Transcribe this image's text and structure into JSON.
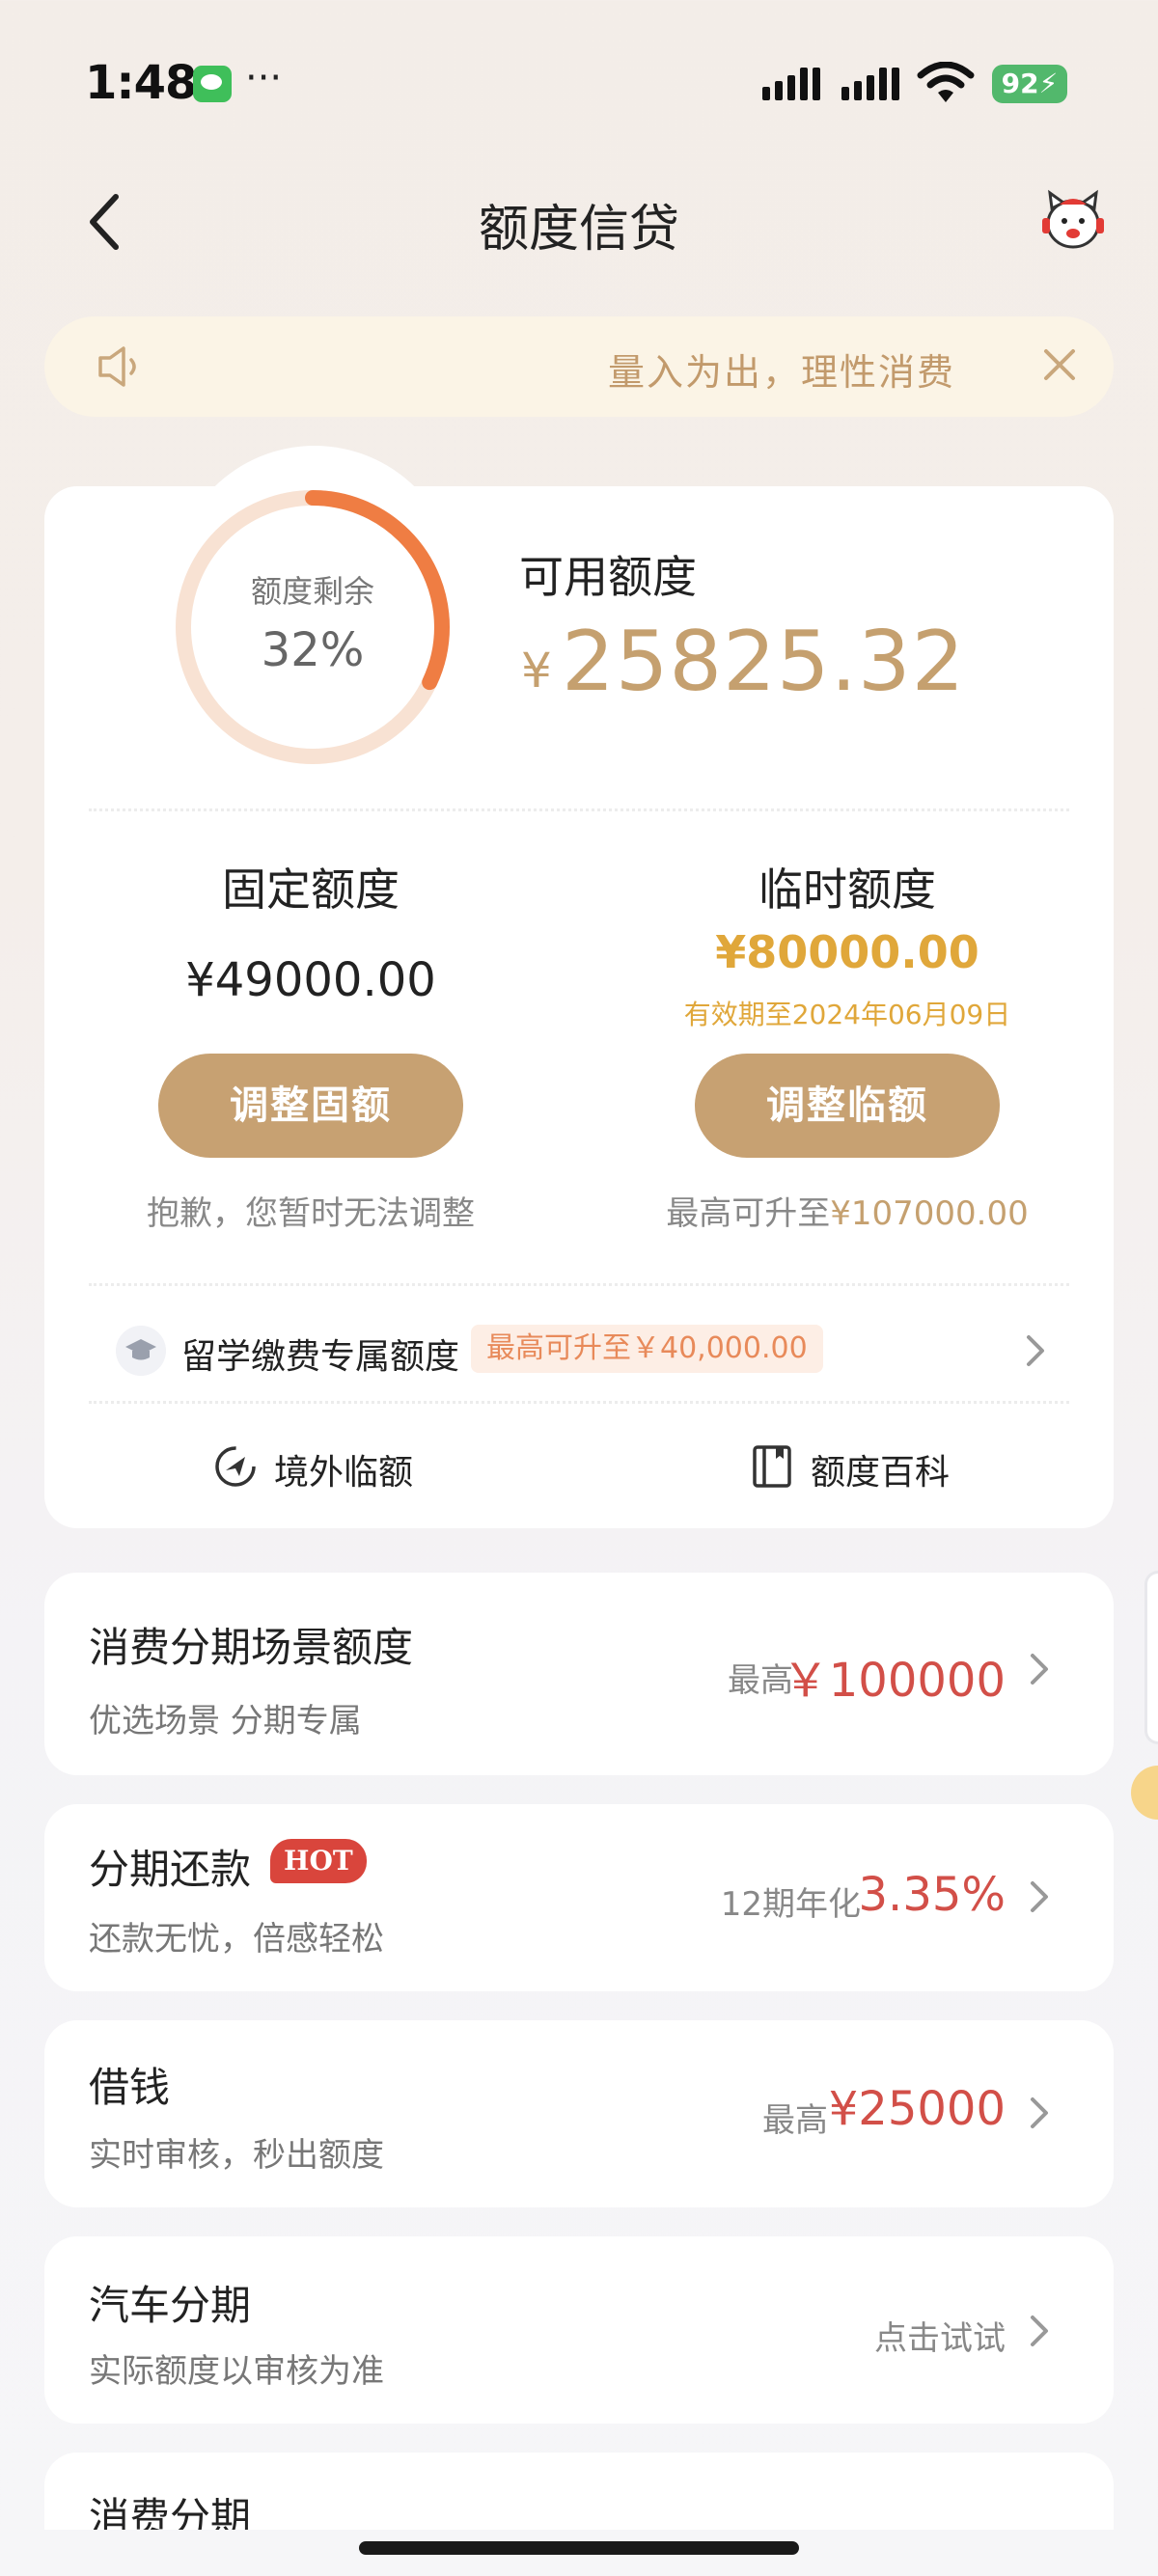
{
  "status_bar": {
    "time": "1:48",
    "dots": "···",
    "battery": "92"
  },
  "header": {
    "title": "额度信贷"
  },
  "notice": {
    "text": "量入为出，理性消费"
  },
  "credit": {
    "remaining_label": "额度剩余",
    "remaining_percent": "32%",
    "remaining_fraction": 0.32,
    "available_label": "可用额度",
    "currency_symbol": "¥",
    "available_amount": "25825.32",
    "fixed": {
      "title": "固定额度",
      "amount": "¥49000.00",
      "button": "调整固额",
      "note": "抱歉，您暂时无法调整"
    },
    "temporary": {
      "title": "临时额度",
      "amount": "¥80000.00",
      "expiry": "有效期至2024年06月09日",
      "button": "调整临额",
      "note_prefix": "最高可升至",
      "note_amount": "¥107000.00"
    },
    "study_abroad": {
      "label": "留学缴费专属额度",
      "badge": "最高可升至￥40,000.00"
    },
    "links": {
      "overseas": "境外临额",
      "wiki": "额度百科"
    }
  },
  "products": [
    {
      "title": "消费分期场景额度",
      "sub": "优选场景 分期专属",
      "pre": "最高",
      "value": "￥100000"
    },
    {
      "title": "分期还款",
      "badge": "HOT",
      "sub": "还款无忧，倍感轻松",
      "pre": "12期年化",
      "value": "3.35%"
    },
    {
      "title": "借钱",
      "sub": "实时审核，秒出额度",
      "pre": "最高",
      "value": "¥25000"
    },
    {
      "title": "汽车分期",
      "sub": "实际额度以审核为准",
      "pre": "点击试试",
      "value": ""
    },
    {
      "title": "消费分期"
    }
  ],
  "colors": {
    "gold": "#c5a06f",
    "accent_orange": "#ef7d43",
    "red": "#d24f48",
    "amber": "#e0a73a"
  }
}
